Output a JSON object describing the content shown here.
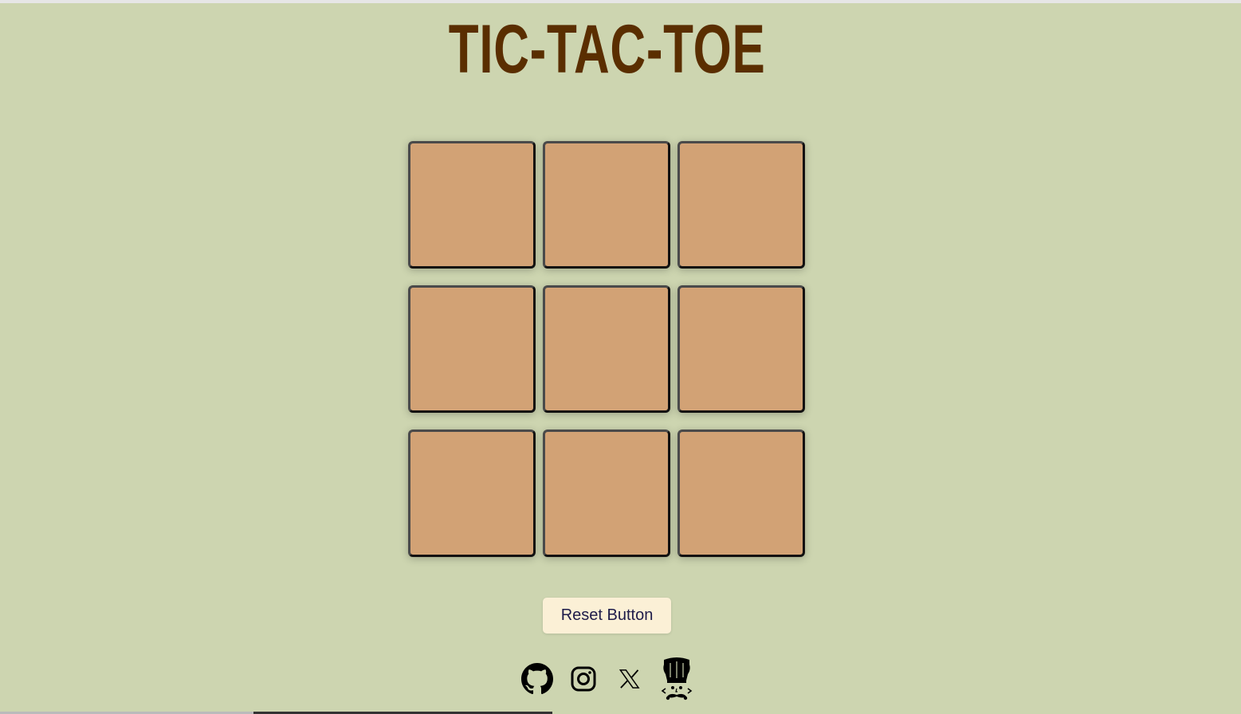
{
  "page": {
    "title": "TIC-TAC-TOE",
    "background_color": "#cdd5b0",
    "title_color": "#5a2e00"
  },
  "board": {
    "cell_color": "#d2a275",
    "cells": [
      "",
      "",
      "",
      "",
      "",
      "",
      "",
      "",
      ""
    ]
  },
  "controls": {
    "reset_label": "Reset Button",
    "reset_bg": "#fbf0d6"
  },
  "socials": [
    {
      "name": "github-icon"
    },
    {
      "name": "instagram-icon"
    },
    {
      "name": "x-icon"
    },
    {
      "name": "chef-avatar-icon"
    }
  ]
}
